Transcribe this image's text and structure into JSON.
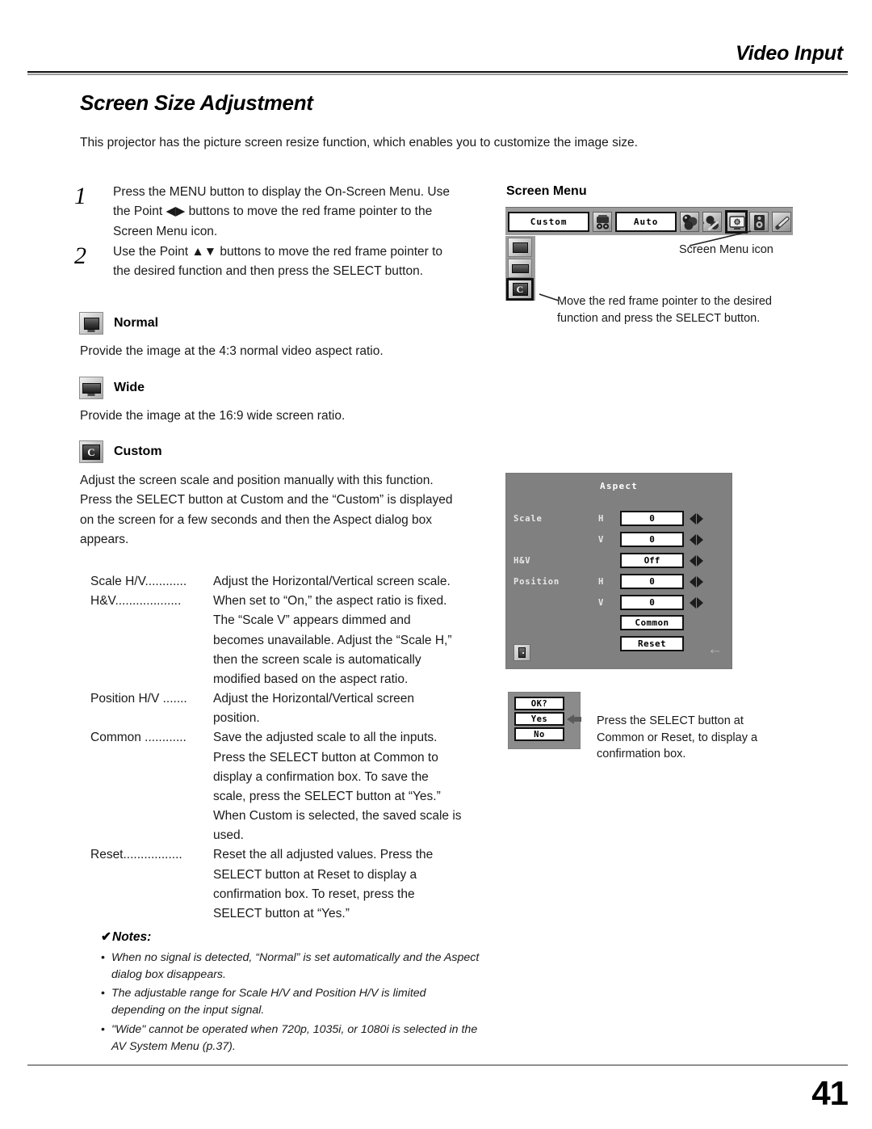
{
  "header": {
    "running_head": "Video Input"
  },
  "section": {
    "title": "Screen Size Adjustment",
    "lead": "This projector has the picture screen resize function, which enables you to customize the image size."
  },
  "steps": [
    {
      "num": "1",
      "text": "Press the MENU button to display the On-Screen Menu. Use the Point ◀▶ buttons to move the red frame pointer to the Screen Menu icon."
    },
    {
      "num": "2",
      "text": "Use the Point ▲▼ buttons to move the red frame pointer to the desired function and then press the SELECT button."
    }
  ],
  "modes": {
    "normal": {
      "label": "Normal",
      "icon": "normal-screen-icon",
      "body": "Provide the image at the 4:3 normal video aspect ratio."
    },
    "wide": {
      "label": "Wide",
      "icon": "wide-screen-icon",
      "body": "Provide the image at the 16:9 wide screen ratio."
    },
    "custom": {
      "label": "Custom",
      "icon": "custom-screen-icon",
      "icon_glyph": "C",
      "body_1": "Adjust the screen scale and position manually with this function.",
      "body_2": "Press the SELECT button at Custom and the “Custom” is displayed on the screen for a few seconds and then the Aspect dialog box appears."
    }
  },
  "definitions": [
    {
      "term": "Scale H/V............",
      "desc": "Adjust the Horizontal/Vertical screen scale."
    },
    {
      "term": "H&V...................",
      "desc": "When set to “On,” the aspect ratio is fixed. The “Scale V” appears dimmed and becomes unavailable. Adjust the “Scale H,” then the screen scale is automatically modified based on the aspect ratio."
    },
    {
      "term": "Position H/V .......",
      "desc": "Adjust the Horizontal/Vertical screen position."
    },
    {
      "term": "Common ............",
      "desc": "Save the adjusted scale to all the inputs. Press the SELECT button at Common to display a confirmation box. To save the scale, press the SELECT button at “Yes.” When Custom is selected, the saved scale is used."
    },
    {
      "term": "Reset.................",
      "desc": "Reset the all adjusted values. Press the SELECT button at Reset to display a confirmation box. To reset, press the SELECT button at “Yes.”"
    }
  ],
  "notes": {
    "check": "✔",
    "heading": "Notes:",
    "bullet": "•",
    "items": [
      "When no signal is detected, “Normal” is set automatically and the Aspect dialog box disappears.",
      "The adjustable range for Scale H/V and Position H/V is limited depending on the input signal.",
      "\"Wide\" cannot be operated when 720p, 1035i, or 1080i is selected in the AV System Menu (p.37)."
    ]
  },
  "osd": {
    "screen_menu_heading": "Screen Menu",
    "menubar": {
      "input_value": "Custom",
      "system_value": "Auto",
      "icons": [
        "input-source-icon",
        "color-adjust-icon",
        "image-select-icon",
        "screen-menu-icon",
        "sound-icon",
        "setting-icon"
      ],
      "selected_icon": "screen-menu-icon"
    },
    "strip": {
      "items": [
        "normal-screen-icon",
        "wide-screen-icon",
        "custom-screen-icon"
      ],
      "custom_glyph": "C",
      "selected": "custom-screen-icon"
    },
    "callouts": {
      "menu_icon": "Screen Menu icon",
      "move_pointer": "Move the red frame pointer to the desired function and press the SELECT button.",
      "confirm": "Press the SELECT button at Common or Reset, to display a confirmation box."
    },
    "aspect_dialog": {
      "title": "Aspect",
      "rows": [
        {
          "label": "Scale",
          "axis": "H",
          "value": "0"
        },
        {
          "label": "",
          "axis": "V",
          "value": "0"
        },
        {
          "label": "H&V",
          "axis": "",
          "value": "Off"
        },
        {
          "label": "Position",
          "axis": "H",
          "value": "0"
        },
        {
          "label": "",
          "axis": "V",
          "value": "0"
        }
      ],
      "buttons": [
        "Common",
        "Reset"
      ],
      "exit_icon": "exit-door-icon",
      "back_arrow": "←"
    },
    "confirm_box": {
      "title": "OK?",
      "yes": "Yes",
      "no": "No"
    }
  },
  "footer": {
    "page_number": "41"
  },
  "colors": {
    "osd_bar": "#9d9d9d",
    "osd_dialog": "#808080",
    "confirm_bg": "#8b8b8b",
    "rule": "#8f8f8f",
    "text": "#1a1a1a"
  }
}
